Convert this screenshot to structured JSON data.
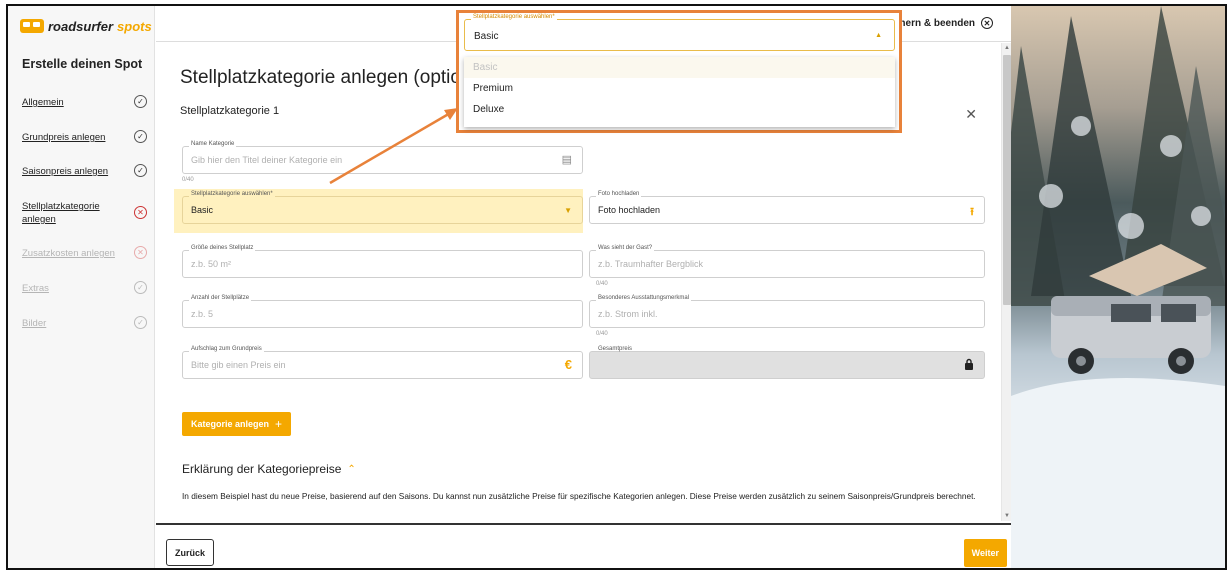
{
  "brand": {
    "name_part1": "roadsurfer",
    "name_part2": "spots"
  },
  "sidebar": {
    "title": "Erstelle deinen Spot",
    "items": [
      {
        "label": "Allgemein",
        "status": "✓"
      },
      {
        "label": "Grundpreis anlegen",
        "status": "✓"
      },
      {
        "label": "Saisonpreis anlegen",
        "status": "✓"
      },
      {
        "label": "Stellplatzkategorie anlegen",
        "status": "✕"
      },
      {
        "label": "Zusatzkosten anlegen",
        "status": "✕"
      },
      {
        "label": "Extras",
        "status": "✓"
      },
      {
        "label": "Bilder",
        "status": "✓"
      }
    ]
  },
  "topbar": {
    "save_exit_label": "beichern & beenden",
    "close_symbol": "✕"
  },
  "main": {
    "page_title": "Stellplatzkategorie anlegen (optional)",
    "section_title": "Stellplatzkategorie 1",
    "close_symbol": "✕",
    "fields": {
      "name": {
        "label": "Name Kategorie",
        "placeholder": "Gib hier den Titel deiner Kategorie ein",
        "counter": "0/40",
        "icon": "▤"
      },
      "category": {
        "label": "Stellplatzkategorie auswählen*",
        "value": "Basic",
        "icon": "▼"
      },
      "photo": {
        "label": "Foto hochladen",
        "value": "Foto hochladen",
        "icon": "⭱"
      },
      "size": {
        "label": "Größe deines Stellplatz",
        "placeholder": "z.b. 50 m²"
      },
      "guest_view": {
        "label": "Was sieht der Gast?",
        "placeholder": "z.b. Traumhafter Bergblick",
        "counter": "0/40"
      },
      "count": {
        "label": "Anzahl der Stellplätze",
        "placeholder": "z.b. 5"
      },
      "feature": {
        "label": "Besonderes Ausstattungsmerkmal",
        "placeholder": "z.b. Strom inkl.",
        "counter": "0/40"
      },
      "surcharge": {
        "label": "Aufschlag zum Grundpreis",
        "placeholder": "Bitte gib einen Preis ein",
        "icon": "€"
      },
      "total": {
        "label": "Gesamtpreis",
        "icon": "🔒"
      }
    },
    "add_button": {
      "label": "Kategorie anlegen",
      "icon": "+"
    },
    "explanation": {
      "title": "Erklärung der Kategoriepreise",
      "chevron": "⌃",
      "text": "In diesem Beispiel hast du neue Preise, basierend auf den Saisons. Du kannst nun zusätzliche Preise für spezifische Kategorien anlegen. Diese Preise werden zusätzlich zu seinem Saisonpreis/Grundpreis berechnet."
    }
  },
  "dropdown": {
    "label": "Stellplatzkategorie auswählen*",
    "value": "Basic",
    "caret": "▲",
    "options": [
      "Basic",
      "Premium",
      "Deluxe"
    ]
  },
  "footer": {
    "back_label": "Zurück",
    "next_label": "Weiter"
  },
  "colors": {
    "accent": "#f4a800",
    "highlight": "#fff1bf",
    "annotation": "#e8823a"
  }
}
